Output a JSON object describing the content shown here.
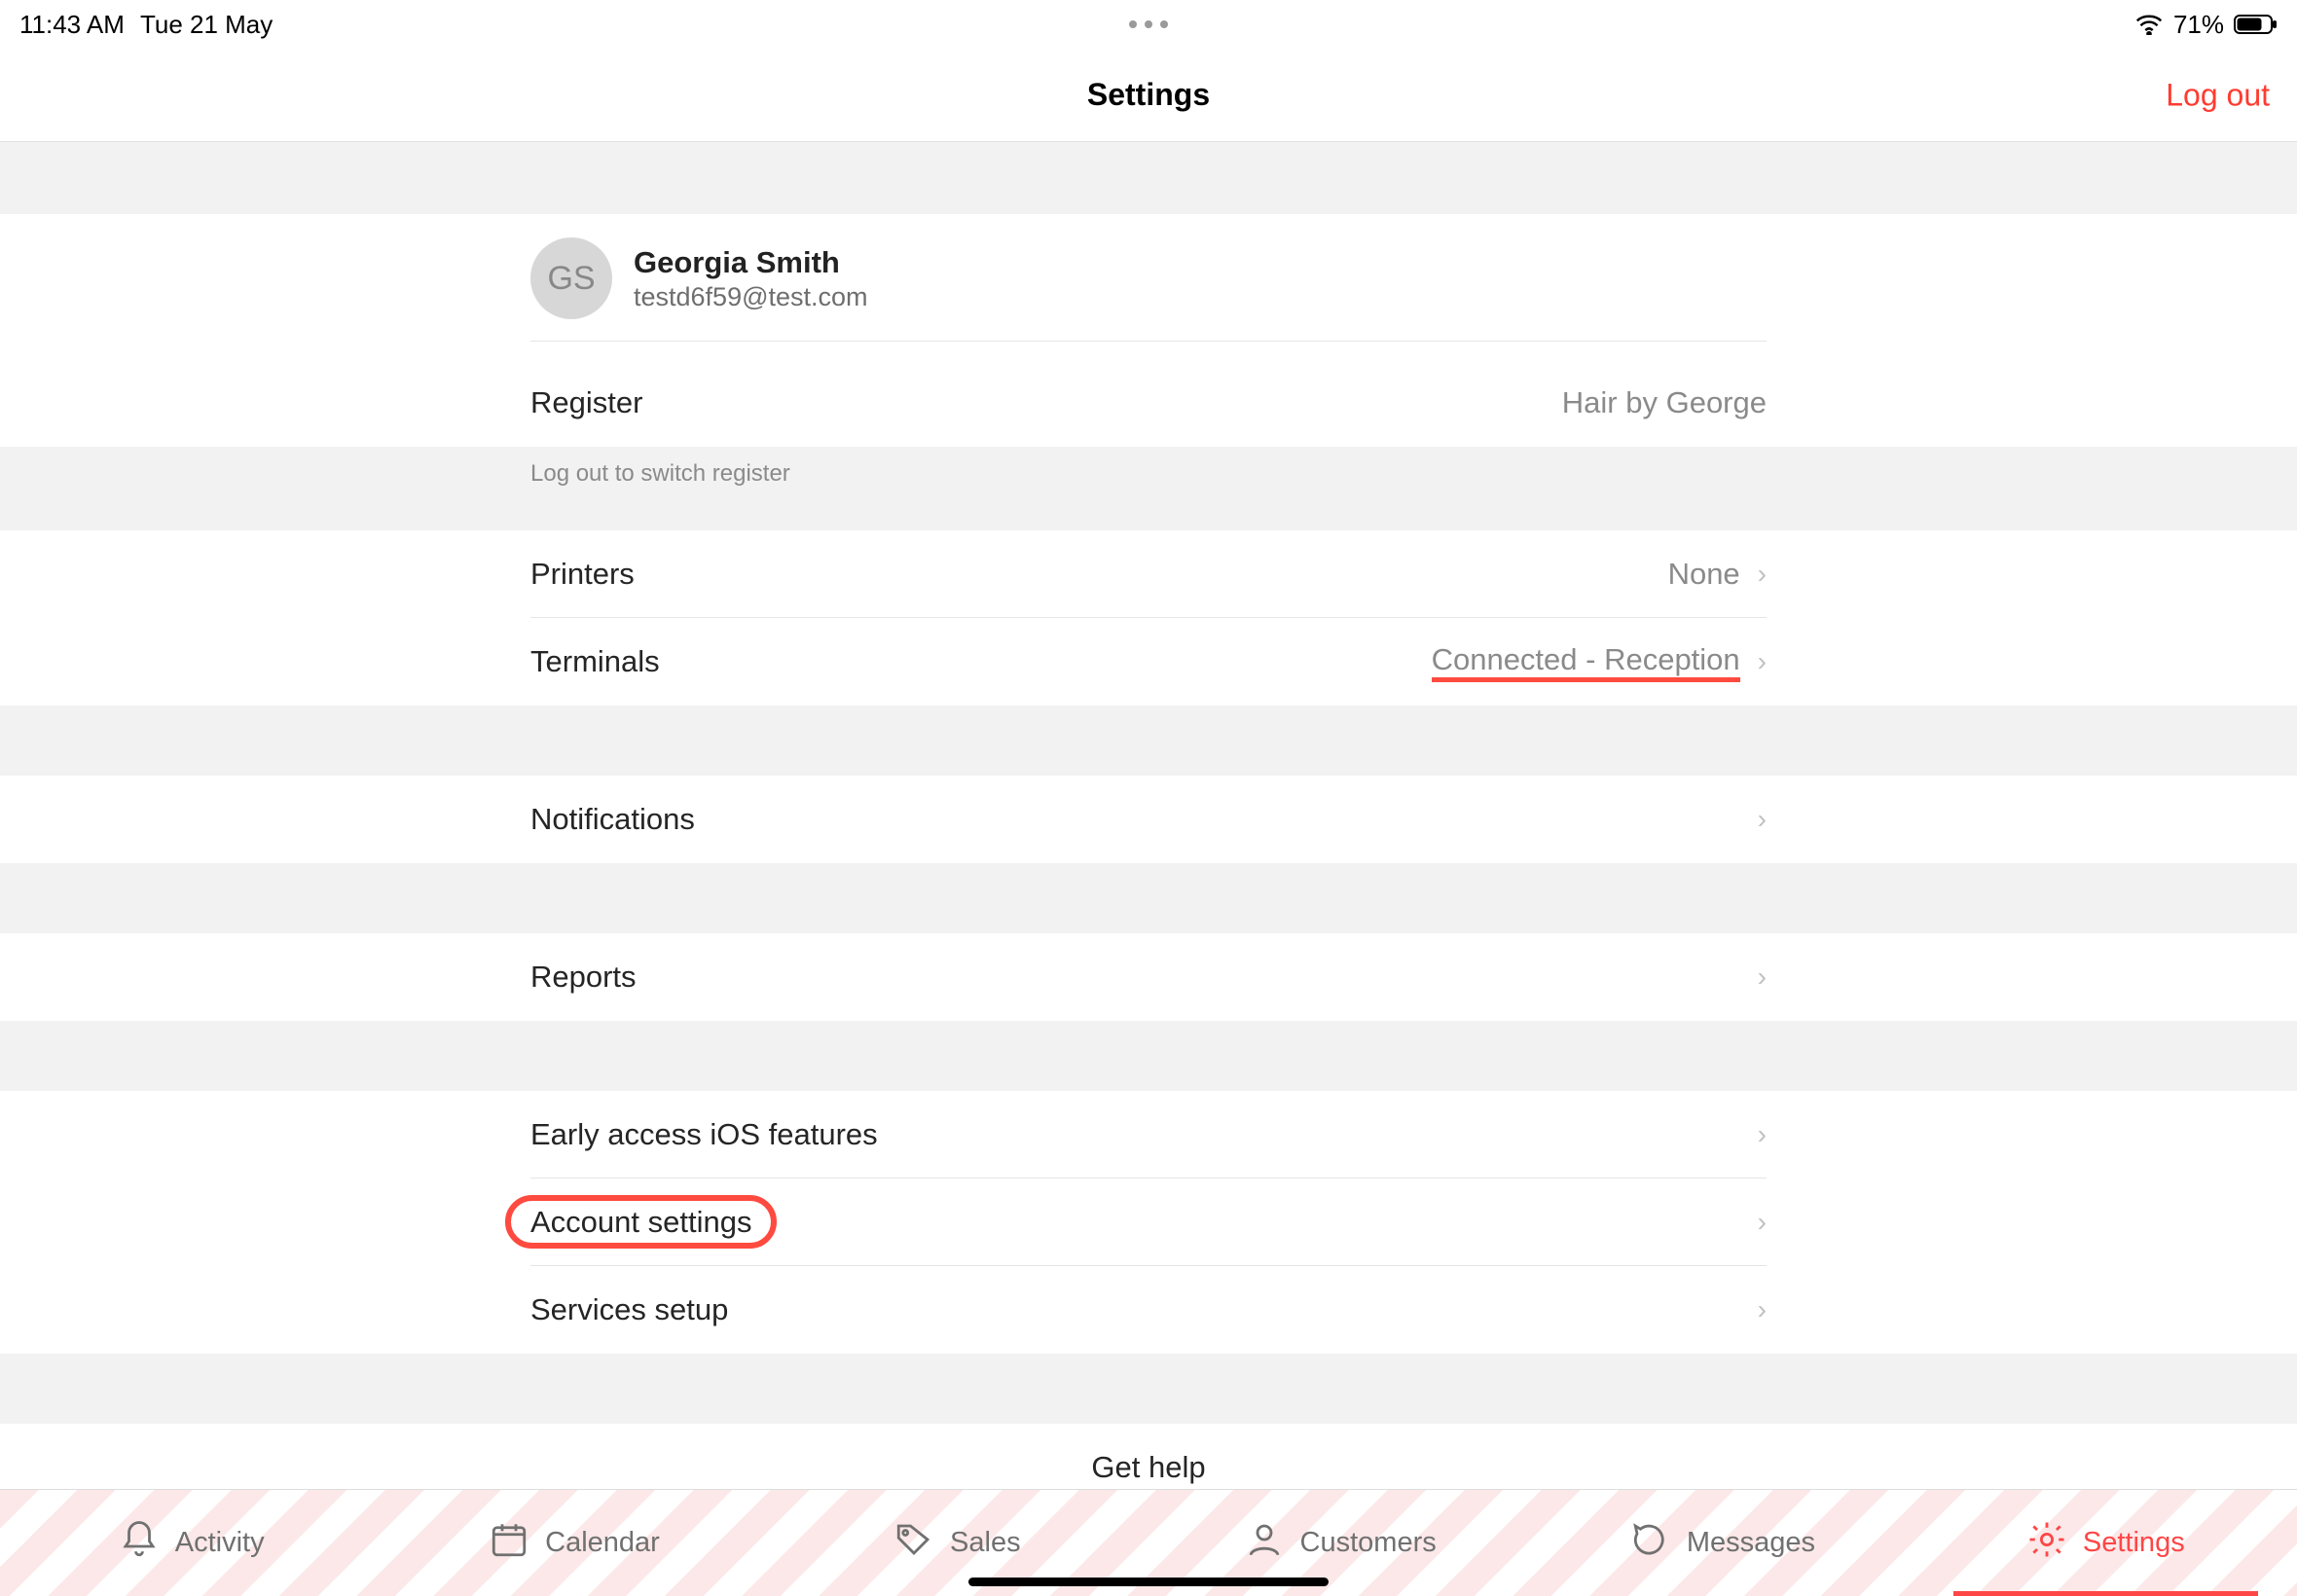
{
  "statusBar": {
    "time": "11:43 AM",
    "date": "Tue 21 May",
    "battery": "71%"
  },
  "header": {
    "title": "Settings",
    "logout": "Log out"
  },
  "profile": {
    "initials": "GS",
    "name": "Georgia Smith",
    "email": "testd6f59@test.com"
  },
  "register": {
    "label": "Register",
    "value": "Hair by George",
    "note": "Log out to switch register"
  },
  "devices": {
    "printers": {
      "label": "Printers",
      "value": "None"
    },
    "terminals": {
      "label": "Terminals",
      "value": "Connected - Reception"
    }
  },
  "rows": {
    "notifications": "Notifications",
    "reports": "Reports",
    "earlyAccess": "Early access iOS features",
    "accountSettings": "Account settings",
    "servicesSetup": "Services setup",
    "getHelp": "Get help"
  },
  "tabs": {
    "activity": "Activity",
    "calendar": "Calendar",
    "sales": "Sales",
    "customers": "Customers",
    "messages": "Messages",
    "settings": "Settings"
  }
}
